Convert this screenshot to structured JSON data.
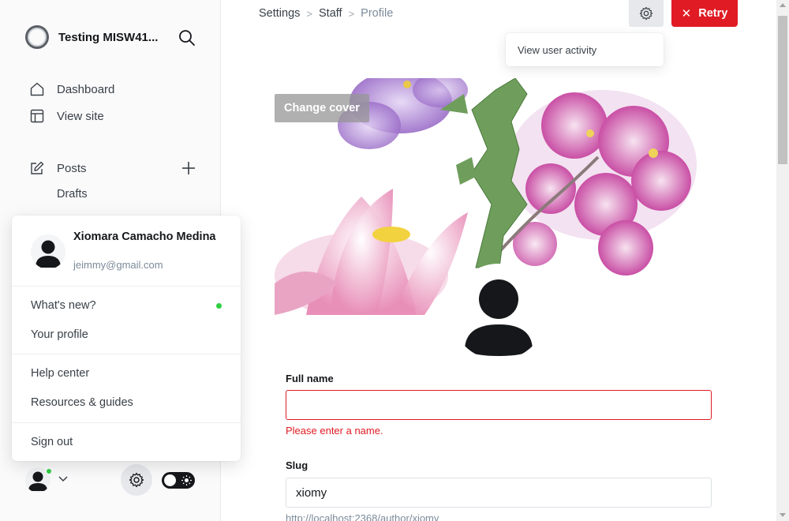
{
  "sidebar": {
    "site_title": "Testing MISW41...",
    "nav": {
      "dashboard": "Dashboard",
      "view_site": "View site",
      "posts": "Posts",
      "drafts": "Drafts"
    }
  },
  "user_menu": {
    "name": "Xiomara Camacho Medina",
    "email": "jeimmy@gmail.com",
    "items": {
      "whats_new": "What's new?",
      "your_profile": "Your profile",
      "help_center": "Help center",
      "resources": "Resources & guides",
      "sign_out": "Sign out"
    }
  },
  "header": {
    "breadcrumb": [
      "Settings",
      "Staff",
      "Profile"
    ],
    "retry_label": "Retry",
    "activity_menu_item": "View user activity"
  },
  "profile": {
    "change_cover_label": "Change cover",
    "full_name": {
      "label": "Full name",
      "value": "",
      "error": "Please enter a name."
    },
    "slug": {
      "label": "Slug",
      "value": "xiomy",
      "hint": "http://localhost:2368/author/xiomy"
    }
  },
  "colors": {
    "accent_red": "#e01b24",
    "online_green": "#30cf43"
  }
}
